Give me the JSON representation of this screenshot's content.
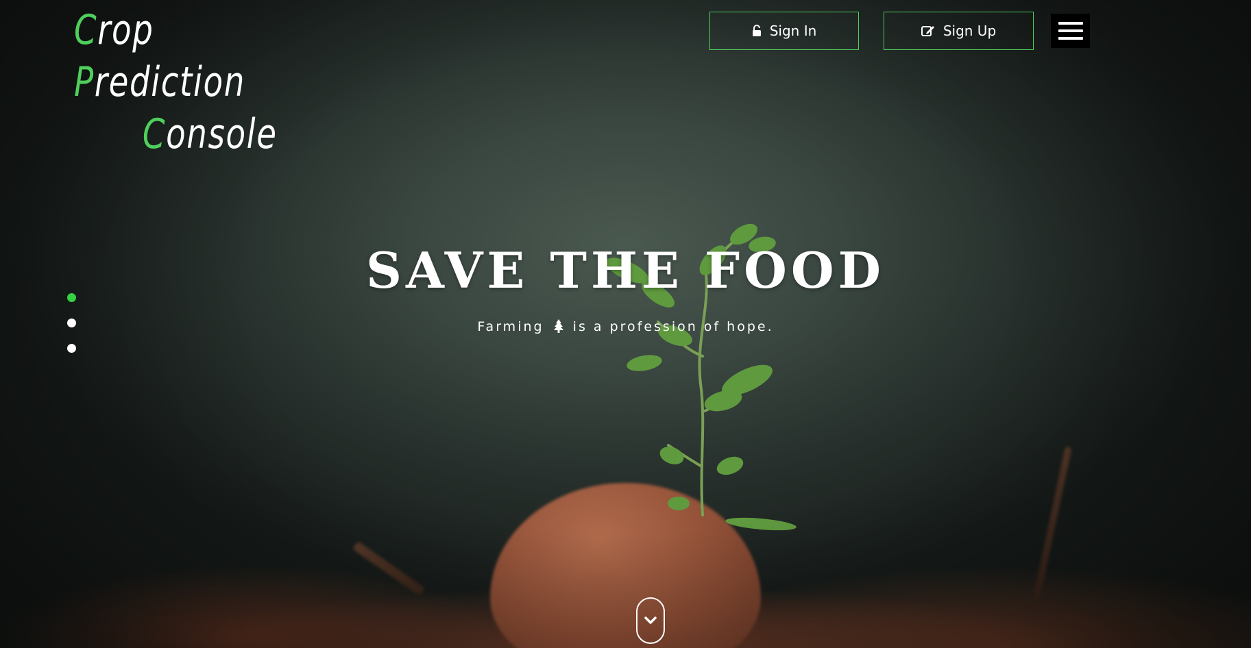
{
  "logo": {
    "line1_initial1": "C",
    "line1_rest1": "rop ",
    "line1_initial2": "P",
    "line1_rest2": "rediction",
    "line2_initial": "C",
    "line2_rest": "onsole"
  },
  "header": {
    "sign_in_label": "Sign In",
    "sign_in_icon": "unlock-icon",
    "sign_up_label": "Sign Up",
    "sign_up_icon": "edit-icon",
    "menu_icon": "hamburger-menu-icon"
  },
  "slider": {
    "dots": 3,
    "active_index": 0
  },
  "hero": {
    "headline": "SAVE THE FOOD",
    "tagline_before": "Farming",
    "tagline_icon": "tree-icon",
    "tagline_after": "is a profession of hope."
  },
  "scroll_icon": "chevron-down-icon",
  "colors": {
    "accent": "#4fcf5c",
    "active_dot": "#35d142",
    "text": "#ffffff",
    "menu_bg": "#000000"
  }
}
